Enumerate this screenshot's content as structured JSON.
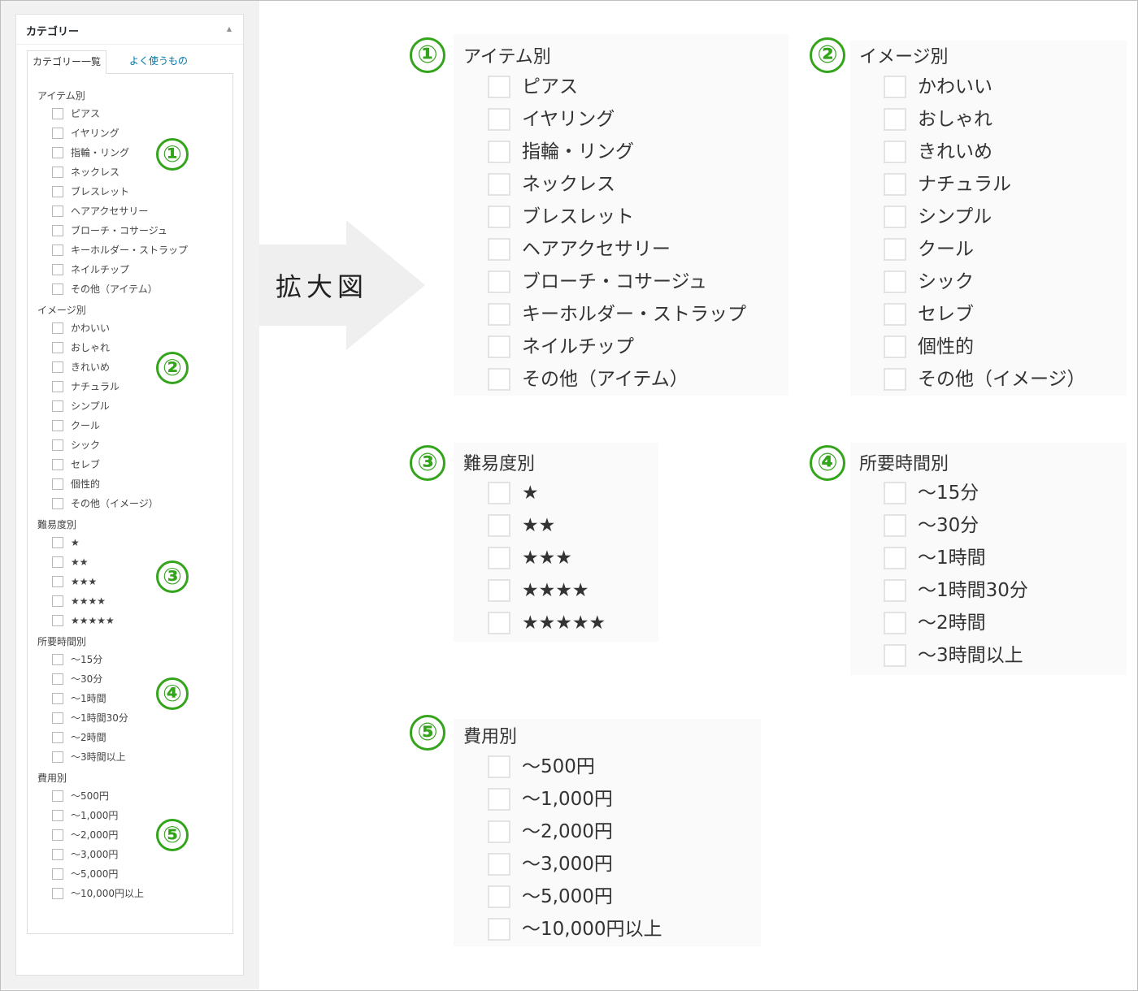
{
  "panel": {
    "title": "カテゴリー",
    "toggle": "▲",
    "tabs": [
      "カテゴリー一覧",
      "よく使うもの"
    ]
  },
  "arrow_label": "拡大図",
  "numbers": [
    "①",
    "②",
    "③",
    "④",
    "⑤"
  ],
  "groups": [
    {
      "name": "アイテム別",
      "items": [
        "ピアス",
        "イヤリング",
        "指輪・リング",
        "ネックレス",
        "ブレスレット",
        "ヘアアクセサリー",
        "ブローチ・コサージュ",
        "キーホルダー・ストラップ",
        "ネイルチップ",
        "その他（アイテム）"
      ]
    },
    {
      "name": "イメージ別",
      "items": [
        "かわいい",
        "おしゃれ",
        "きれいめ",
        "ナチュラル",
        "シンプル",
        "クール",
        "シック",
        "セレブ",
        "個性的",
        "その他（イメージ）"
      ]
    },
    {
      "name": "難易度別",
      "items": [
        "★",
        "★★",
        "★★★",
        "★★★★",
        "★★★★★"
      ]
    },
    {
      "name": "所要時間別",
      "items": [
        "〜15分",
        "〜30分",
        "〜1時間",
        "〜1時間30分",
        "〜2時間",
        "〜3時間以上"
      ]
    },
    {
      "name": "費用別",
      "items": [
        "〜500円",
        "〜1,000円",
        "〜2,000円",
        "〜3,000円",
        "〜5,000円",
        "〜10,000円以上"
      ]
    }
  ],
  "colors": {
    "accent": "#35a41d",
    "link": "#0073aa",
    "arrow": "#efefef"
  }
}
